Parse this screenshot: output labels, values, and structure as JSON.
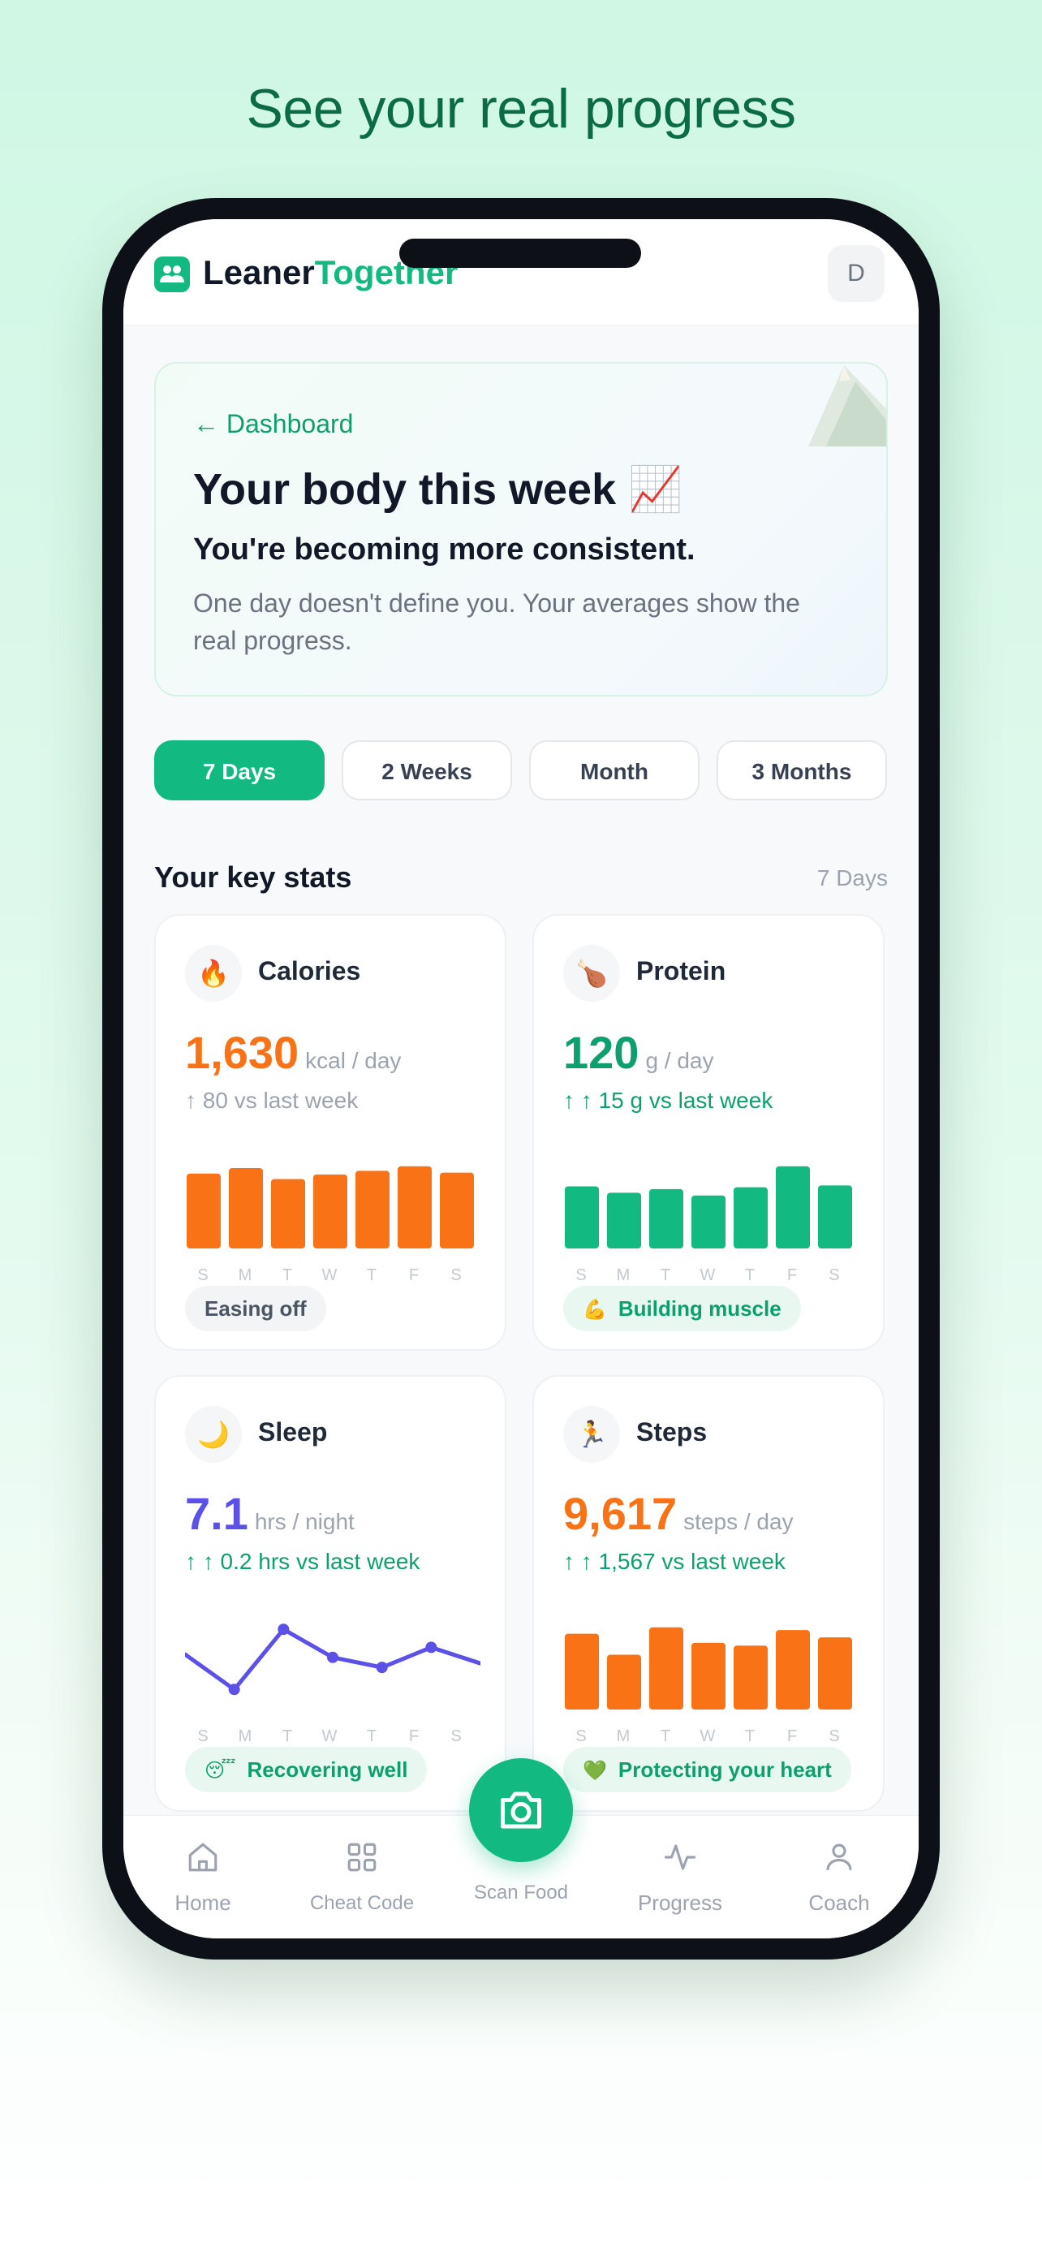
{
  "headline": "See your real progress",
  "app": {
    "brand_primary": "Leaner",
    "brand_accent": "Together",
    "avatar_initial": "D"
  },
  "hero": {
    "back_label": "← Dashboard",
    "title": "Your body this week 📈",
    "subtitle": "You're becoming more consistent.",
    "body": "One day doesn't define you. Your averages show the real progress."
  },
  "tabs": [
    {
      "label": "7 Days",
      "active": true
    },
    {
      "label": "2 Weeks",
      "active": false
    },
    {
      "label": "Month",
      "active": false
    },
    {
      "label": "3 Months",
      "active": false
    }
  ],
  "section": {
    "title": "Your key stats",
    "range": "7 Days"
  },
  "days": [
    "S",
    "M",
    "T",
    "W",
    "T",
    "F",
    "S"
  ],
  "cards": [
    {
      "name": "Calories",
      "icon": "🔥",
      "value": "1,630",
      "unit": "kcal / day",
      "delta": "↑ 80 vs last week",
      "status": "Easing off",
      "status_icon": "",
      "chart_type": "bar",
      "color": "#f97316",
      "delta_color": "#9ca3af",
      "pill_bg": "#f3f4f6",
      "pill_color": "#4b5563",
      "values": [
        0.82,
        0.88,
        0.76,
        0.81,
        0.85,
        0.9,
        0.83
      ]
    },
    {
      "name": "Protein",
      "icon": "🍗",
      "value": "120",
      "unit": "g / day",
      "delta": "↑ ↑ 15 g vs last week",
      "status": "Building muscle",
      "status_icon": "💪",
      "chart_type": "bar",
      "color": "#12b981",
      "value_color": "#0e9f6e",
      "delta_color": "#0e9f6e",
      "pill_bg": "#e8f8f0",
      "pill_color": "#0e9f6e",
      "values": [
        0.68,
        0.61,
        0.65,
        0.58,
        0.67,
        0.9,
        0.69
      ]
    },
    {
      "name": "Sleep",
      "icon": "🌙",
      "value": "7.1",
      "unit": "hrs / night",
      "delta": "↑ ↑ 0.2 hrs vs last week",
      "status": "Recovering well",
      "status_icon": "😴",
      "chart_type": "line",
      "color": "#5b50e8",
      "delta_color": "#0e9f6e",
      "pill_bg": "#e8f8f0",
      "pill_color": "#0e9f6e",
      "values": [
        0.55,
        0.2,
        0.8,
        0.52,
        0.42,
        0.62,
        0.46
      ]
    },
    {
      "name": "Steps",
      "icon": "🏃",
      "value": "9,617",
      "unit": "steps / day",
      "delta": "↑ ↑ 1,567 vs last week",
      "status": "Protecting your heart",
      "status_icon": "💚",
      "chart_type": "bar",
      "color": "#f97316",
      "delta_color": "#0e9f6e",
      "pill_bg": "#e8f8f0",
      "pill_color": "#0e9f6e",
      "values": [
        0.83,
        0.6,
        0.9,
        0.73,
        0.7,
        0.87,
        0.79
      ]
    }
  ],
  "nav": {
    "home": "Home",
    "cheat_code": "Cheat Code",
    "scan_food": "Scan Food",
    "progress": "Progress",
    "coach": "Coach"
  },
  "colors": {
    "accent": "#12b981",
    "brand_dark": "#0b6b45"
  }
}
